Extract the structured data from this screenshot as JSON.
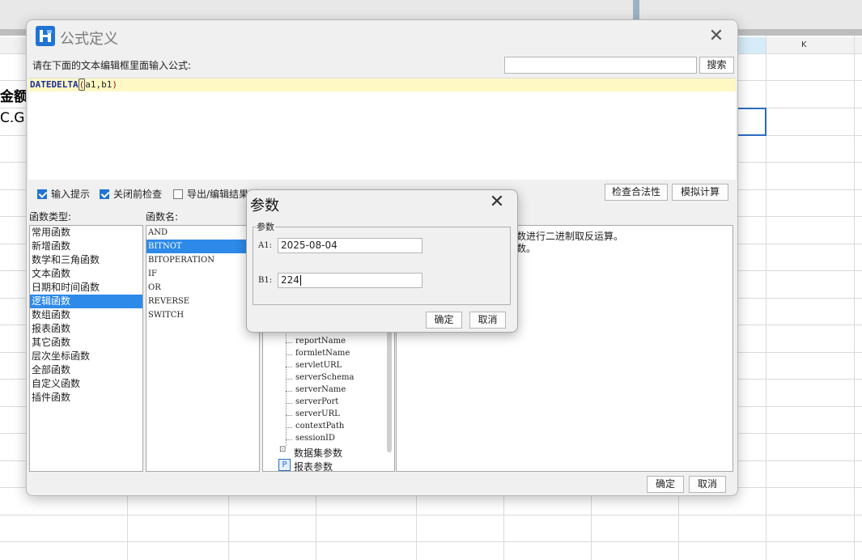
{
  "sheet": {
    "column_k": "K",
    "cell_bold": "金额",
    "cell_text": "C.G("
  },
  "dialog": {
    "title": "公式定义",
    "prompt": "请在下面的文本编辑框里面输入公式:",
    "search_placeholder": "",
    "search_button": "搜索",
    "formula": {
      "fn": "DATEDELTA",
      "open": "(",
      "args": "a1,b1",
      "close": ")"
    },
    "options": {
      "input_hint": "输入提示",
      "check_before_close": "关闭前检查",
      "export_edit": "导出/编辑结果时"
    },
    "check_validity": "检查合法性",
    "simulate": "模拟计算",
    "function_type_label": "函数类型:",
    "function_name_label": "函数名:",
    "function_types": [
      "常用函数",
      "新增函数",
      "数学和三角函数",
      "文本函数",
      "日期和时间函数",
      "逻辑函数",
      "数组函数",
      "报表函数",
      "其它函数",
      "层次坐标函数",
      "全部函数",
      "自定义函数",
      "插件函数"
    ],
    "function_names": [
      "AND",
      "BITNOT",
      "BITOPERATION",
      "IF",
      "OR",
      "REVERSE",
      "SWITCH"
    ],
    "description": [
      "数进行二进制取反运算。",
      "数。"
    ],
    "tree": {
      "items": [
        "reportName",
        "formletName",
        "servletURL",
        "serverSchema",
        "serverName",
        "serverPort",
        "serverURL",
        "contextPath",
        "sessionID"
      ],
      "dataset_params": "数据集参数",
      "report_params": "报表参数"
    },
    "ok": "确定",
    "cancel": "取消"
  },
  "param_dialog": {
    "title": "参数",
    "group_label": "参数",
    "a1_label": "A1:",
    "a1_value": "2025-08-04",
    "b1_label": "B1:",
    "b1_value": "224",
    "ok": "确定",
    "cancel": "取消"
  }
}
